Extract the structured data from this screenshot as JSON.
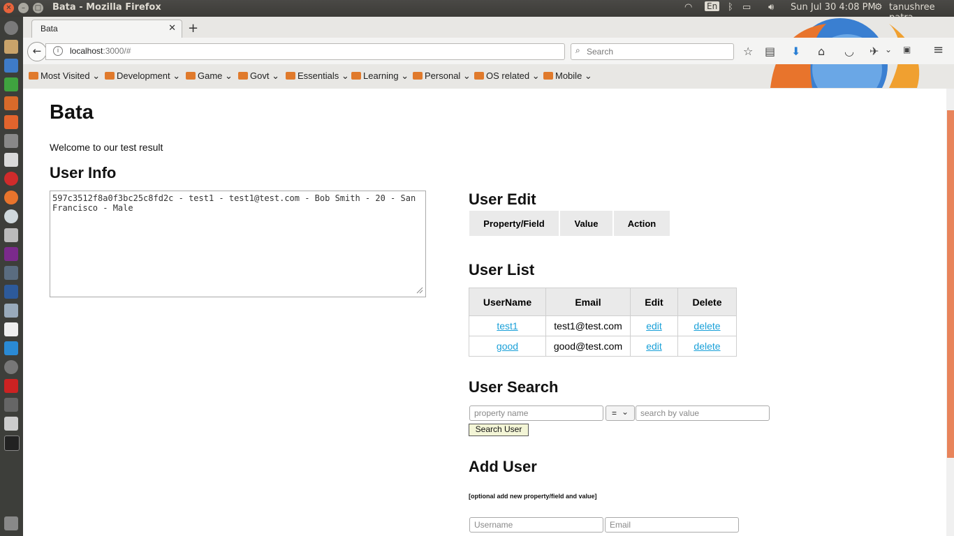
{
  "window": {
    "title": "Bata - Mozilla Firefox"
  },
  "panel": {
    "keyboard_layout": "En",
    "datetime": "Sun Jul 30  4:08 PM",
    "user": "tanushree patra"
  },
  "browser": {
    "tab_title": "Bata",
    "url_host": "localhost",
    "url_rest": ":3000/#",
    "search_placeholder": "Search",
    "bookmarks": [
      "Most Visited",
      "Development",
      "Game",
      "Govt",
      "Essentials",
      "Learning",
      "Personal",
      "OS related",
      "Mobile"
    ]
  },
  "page": {
    "title": "Bata",
    "welcome": "Welcome to our test result",
    "user_info": {
      "heading": "User Info",
      "text": "597c3512f8a0f3bc25c8fd2c - test1 - test1@test.com - Bob Smith - 20 - San Francisco - Male"
    },
    "user_edit": {
      "heading": "User Edit",
      "columns": [
        "Property/Field",
        "Value",
        "Action"
      ]
    },
    "user_list": {
      "heading": "User List",
      "columns": [
        "UserName",
        "Email",
        "Edit",
        "Delete"
      ],
      "rows": [
        {
          "username": "test1",
          "email": "test1@test.com",
          "edit": "edit",
          "delete": "delete"
        },
        {
          "username": "good",
          "email": "good@test.com",
          "edit": "edit",
          "delete": "delete"
        }
      ]
    },
    "user_search": {
      "heading": "User Search",
      "property_placeholder": "property name",
      "operator": "=",
      "value_placeholder": "search by value",
      "button": "Search User"
    },
    "add_user": {
      "heading": "Add User",
      "note": "[optional add new property/field and value]",
      "username_placeholder": "Username",
      "email_placeholder": "Email"
    }
  }
}
